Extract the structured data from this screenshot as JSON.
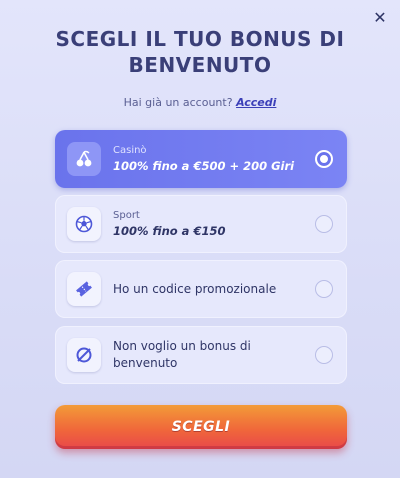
{
  "header": {
    "close_icon": "close-icon",
    "title": "SCEGLI IL TUO BONUS DI BENVENUTO"
  },
  "login": {
    "prompt": "Hai già un account?",
    "link": "Accedi"
  },
  "options": [
    {
      "icon": "cherries-icon",
      "label": "Casinò",
      "value": "100% fino a €500 + 200 Giri",
      "selected": true
    },
    {
      "icon": "soccer-ball-icon",
      "label": "Sport",
      "value": "100% fino a €150",
      "selected": false
    },
    {
      "icon": "ticket-icon",
      "text": "Ho un codice promozionale",
      "selected": false
    },
    {
      "icon": "no-bonus-icon",
      "text": "Non voglio un bonus di benvenuto",
      "selected": false
    }
  ],
  "cta": {
    "label": "SCEGLI"
  },
  "colors": {
    "selected": "#6a73ec",
    "title": "#3a3f78",
    "cta_top": "#f39b38",
    "cta_bottom": "#e9484a"
  }
}
